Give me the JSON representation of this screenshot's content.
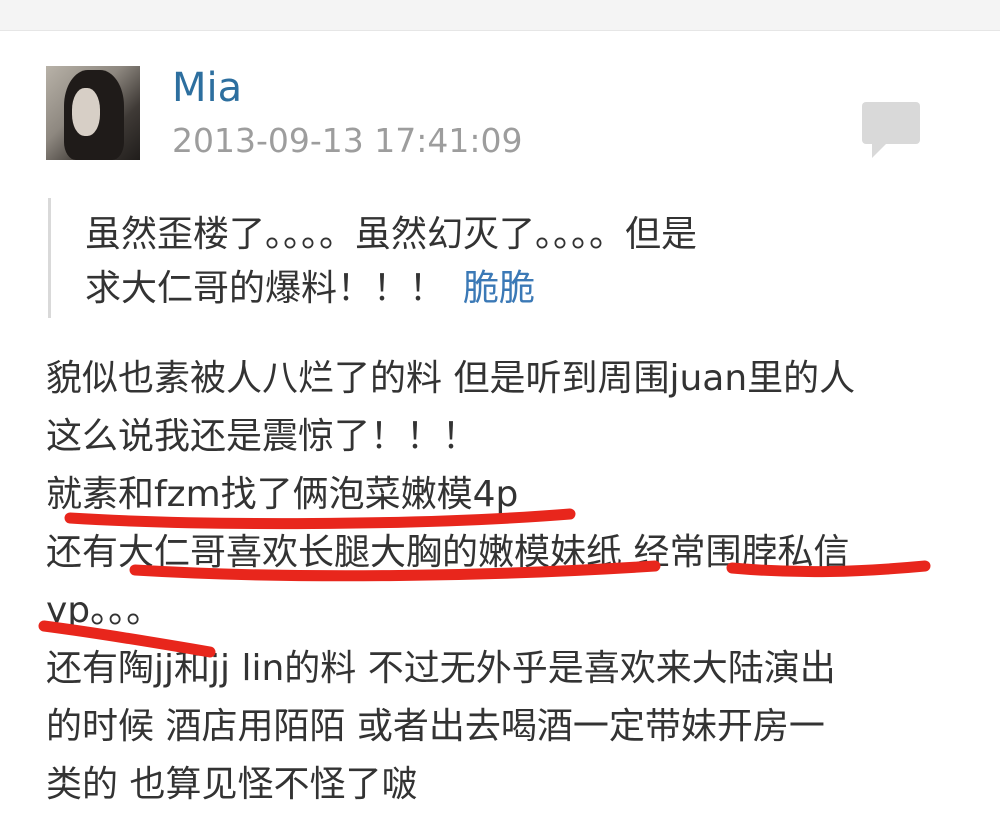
{
  "post": {
    "username": "Mia",
    "timestamp": "2013-09-13 17:41:09",
    "avatar": "avatar-photo",
    "comment_icon": "comment-icon"
  },
  "quote": {
    "line1": "虽然歪楼了。。。。虽然幻灭了。。。。但是",
    "line2": "求大仁哥的爆料！！！",
    "reply_name": "脆脆"
  },
  "content": {
    "lines": [
      "貌似也素被人八烂了的料 但是听到周围juan里的人",
      "这么说我还是震惊了！！！",
      "就素和fzm找了俩泡菜嫩模4p",
      "还有大仁哥喜欢长腿大胸的嫩模妹纸 经常围脖私信",
      "yp。。。",
      "还有陶jj和jj lin的料 不过无外乎是喜欢来大陆演出",
      "的时候 酒店用陌陌 或者出去喝酒一定带妹开房一",
      "类的 也算见怪不怪了啵"
    ]
  },
  "colors": {
    "username": "#2d6f9f",
    "timestamp": "#9d9d9d",
    "reply_name": "#3b79b6",
    "underline": "#e8261c"
  }
}
